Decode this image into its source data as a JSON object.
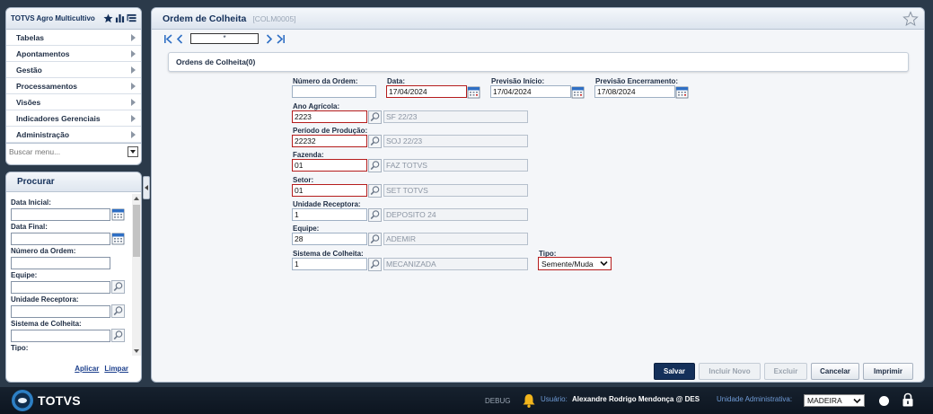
{
  "app": {
    "title": "TOTVS Agro Multicultivo"
  },
  "menu": {
    "items": [
      {
        "label": "Tabelas"
      },
      {
        "label": "Apontamentos"
      },
      {
        "label": "Gestão"
      },
      {
        "label": "Processamentos"
      },
      {
        "label": "Visões"
      },
      {
        "label": "Indicadores Gerenciais"
      },
      {
        "label": "Administração"
      }
    ],
    "search_placeholder": "Buscar menu..."
  },
  "search_panel": {
    "title": "Procurar",
    "fields": {
      "data_inicial": "Data Inicial:",
      "data_final": "Data Final:",
      "numero_ordem": "Número da Ordem:",
      "equipe": "Equipe:",
      "unidade_receptora": "Unidade Receptora:",
      "sistema_colheita": "Sistema de Colheita:",
      "tipo": "Tipo:"
    },
    "apply_label": "Aplicar",
    "clear_label": "Limpar"
  },
  "main": {
    "title": "Ordem de Colheita",
    "code": "[COLM0005]",
    "record_value": "*",
    "card_title": "Ordens de Colheita(0)"
  },
  "form": {
    "numero_ordem": {
      "label": "Número da Ordem:",
      "value": ""
    },
    "data": {
      "label": "Data:",
      "value": "17/04/2024"
    },
    "previsao_inicio": {
      "label": "Previsão Início:",
      "value": "17/04/2024"
    },
    "previsao_encerramento": {
      "label": "Previsão Encerramento:",
      "value": "17/08/2024"
    },
    "ano_agricola": {
      "label": "Ano Agrícola:",
      "code": "2223",
      "description": "SF 22/23"
    },
    "periodo_producao": {
      "label": "Período de Produção:",
      "code": "22232",
      "description": "SOJ 22/23"
    },
    "fazenda": {
      "label": "Fazenda:",
      "code": "01",
      "description": "FAZ TOTVS"
    },
    "setor": {
      "label": "Setor:",
      "code": "01",
      "description": "SET TOTVS"
    },
    "unidade_receptora": {
      "label": "Unidade Receptora:",
      "code": "1",
      "description": "DEPOSITO 24"
    },
    "equipe": {
      "label": "Equipe:",
      "code": "28",
      "description": "ADEMIR"
    },
    "sistema_colheita": {
      "label": "Sistema de Colheita:",
      "code": "1",
      "description": "MECANIZADA"
    },
    "tipo": {
      "label": "Tipo:",
      "value": "Semente/Muda"
    }
  },
  "actions": {
    "salvar": "Salvar",
    "incluir_novo": "Incluir Novo",
    "excluir": "Excluir",
    "cancelar": "Cancelar",
    "imprimir": "Imprimir"
  },
  "footer": {
    "brand": "TOTVS",
    "debug": "DEBUG",
    "user_label": "Usuário:",
    "user_name": "Alexandre Rodrigo Mendonça @ DES",
    "unit_label": "Unidade Administrativa:",
    "unit_value": "MADEIRA"
  },
  "colors": {
    "primary": "#14305a",
    "required_border": "#b51c1c",
    "calendar_accent": "#2f6fc4",
    "footer_bg": "#0d1520"
  }
}
